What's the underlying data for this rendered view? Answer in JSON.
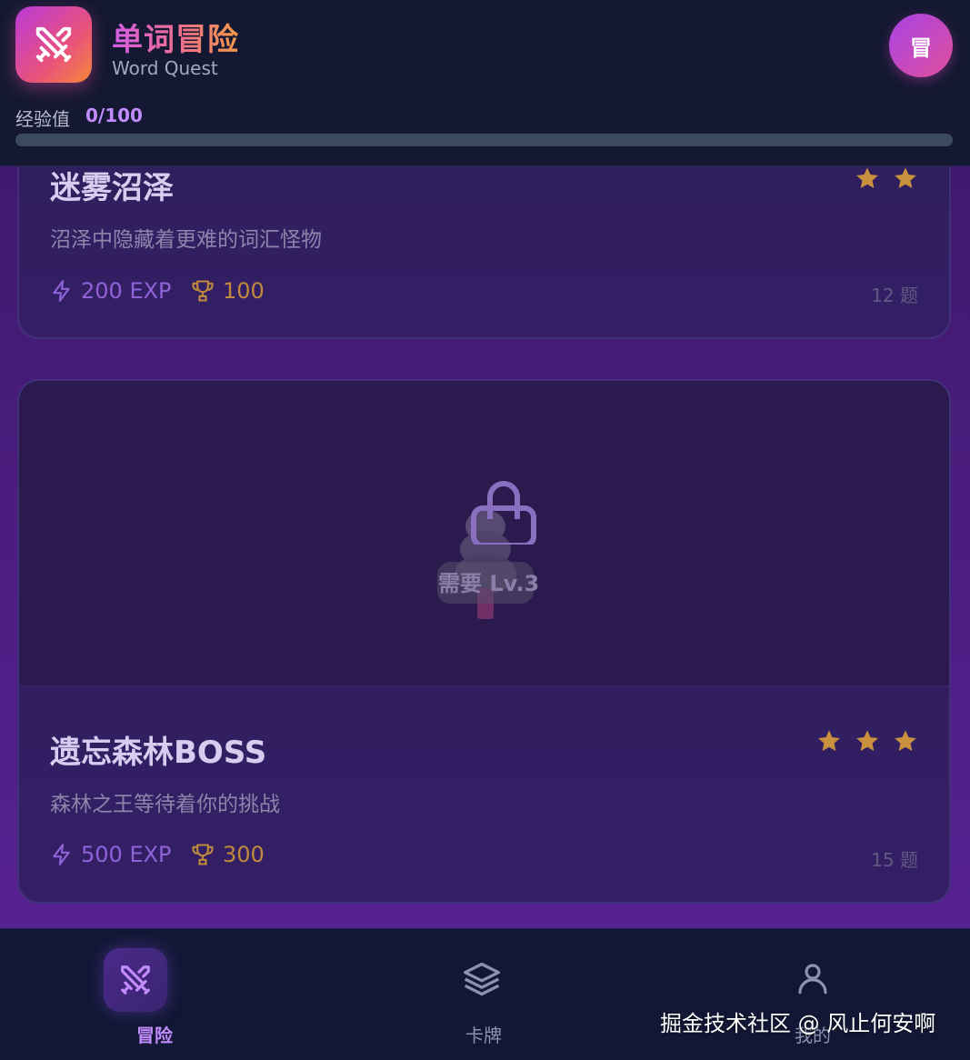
{
  "header": {
    "title": "单词冒险",
    "subtitle": "Word Quest",
    "avatar_label": "冒",
    "xp_label": "经验值",
    "xp_value": "0/100",
    "xp_progress": 0
  },
  "levels": [
    {
      "title": "迷雾沼泽",
      "description": "沼泽中隐藏着更难的词汇怪物",
      "exp": "200 EXP",
      "trophy": "100",
      "questions": "12 题",
      "stars": 2
    },
    {
      "title": "遗忘森林BOSS",
      "description": "森林之王等待着你的挑战",
      "exp": "500 EXP",
      "trophy": "300",
      "questions": "15 题",
      "stars": 3,
      "locked": true,
      "lock_text": "需要 Lv.3"
    }
  ],
  "nav": [
    {
      "label": "冒险",
      "icon": "swords-icon",
      "active": true
    },
    {
      "label": "卡牌",
      "icon": "layers-icon",
      "active": false
    },
    {
      "label": "我的",
      "icon": "user-icon",
      "active": false
    }
  ],
  "watermark": "掘金技术社区 @ 风止何安啊",
  "colors": {
    "accent": "#b040f0",
    "star": "#c9903e",
    "background": "#4b1d80"
  }
}
